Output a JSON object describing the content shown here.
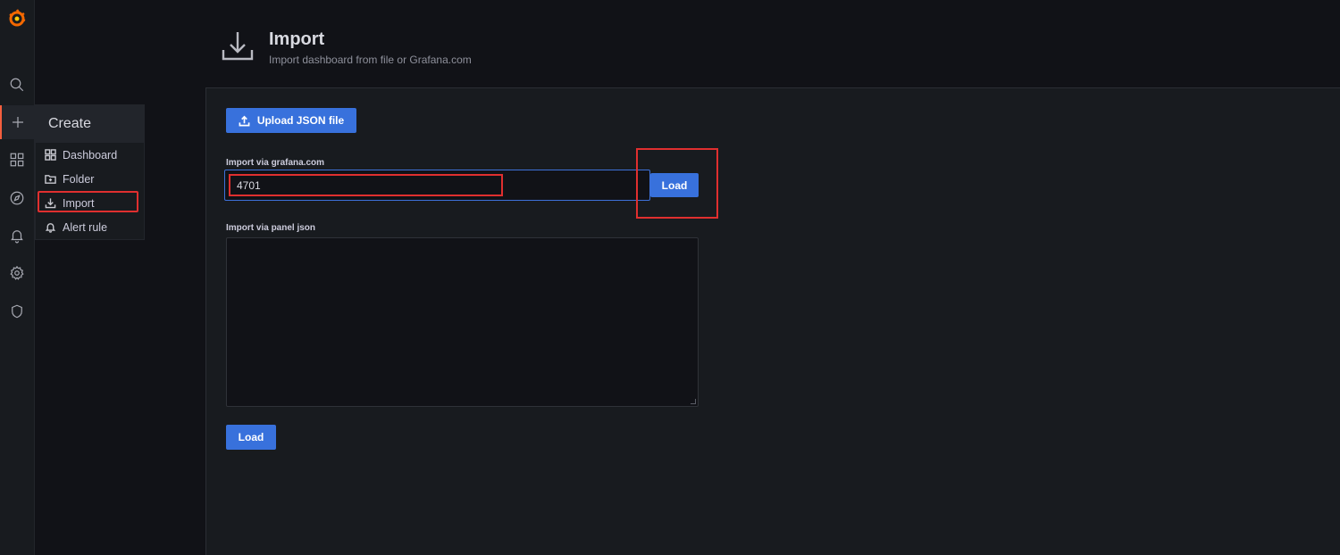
{
  "sidebar": {
    "icons": [
      "grafana-logo-icon",
      "search-icon",
      "plus-icon",
      "dashboards-icon",
      "explore-compass-icon",
      "alerting-bell-icon",
      "configuration-gear-icon",
      "server-admin-shield-icon"
    ],
    "accent_color": "#f55f3e"
  },
  "create_menu": {
    "header": "Create",
    "items": [
      {
        "label": "Dashboard",
        "icon": "dashboard-grid-icon"
      },
      {
        "label": "Folder",
        "icon": "folder-plus-icon"
      },
      {
        "label": "Import",
        "icon": "import-icon"
      },
      {
        "label": "Alert rule",
        "icon": "bell-icon"
      }
    ]
  },
  "page": {
    "title": "Import",
    "subtitle": "Import dashboard from file or Grafana.com",
    "icon": "import-icon"
  },
  "form": {
    "upload_label": "Upload JSON file",
    "grafana_label": "Import via grafana.com",
    "grafana_value": "4701",
    "load_label": "Load",
    "panel_json_label": "Import via panel json",
    "panel_json_value": "",
    "load_label_2": "Load"
  },
  "colors": {
    "primary_button": "#3871dc",
    "annotation_red": "#e02f2f",
    "background": "#111217",
    "panel": "#181b1f"
  }
}
